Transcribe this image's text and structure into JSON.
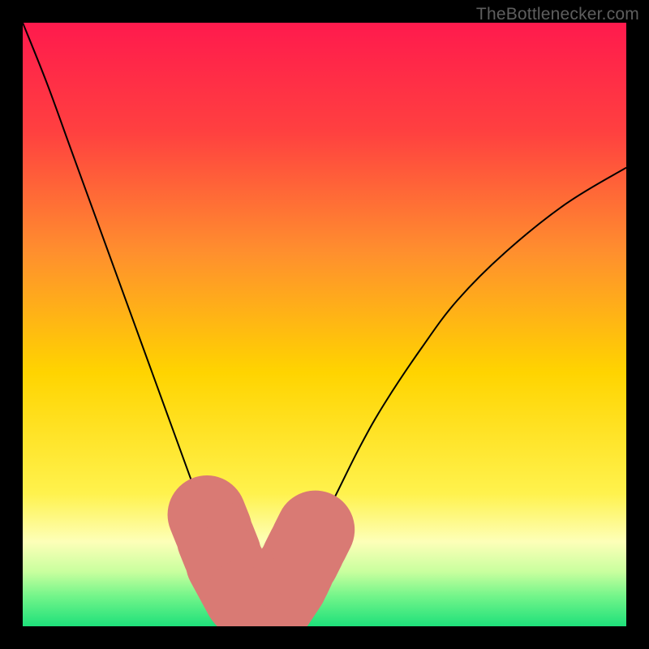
{
  "watermark": "TheBottlenecker.com",
  "chart_data": {
    "type": "line",
    "title": "",
    "xlabel": "",
    "ylabel": "",
    "xlim": [
      0,
      100
    ],
    "ylim": [
      0,
      100
    ],
    "gradient_stops": [
      {
        "t": 0.0,
        "color": "#ff1a4d"
      },
      {
        "t": 0.18,
        "color": "#ff4040"
      },
      {
        "t": 0.38,
        "color": "#ff8f2e"
      },
      {
        "t": 0.58,
        "color": "#ffd400"
      },
      {
        "t": 0.78,
        "color": "#fff24d"
      },
      {
        "t": 0.86,
        "color": "#fdffb8"
      },
      {
        "t": 0.91,
        "color": "#c8ff9e"
      },
      {
        "t": 0.95,
        "color": "#73f58a"
      },
      {
        "t": 1.0,
        "color": "#1ee07a"
      }
    ],
    "series": [
      {
        "name": "bottleneck-curve",
        "x": [
          0,
          4,
          8,
          12,
          16,
          20,
          24,
          28,
          30,
          32,
          34,
          36,
          37,
          38,
          39,
          40,
          42,
          44,
          46,
          48,
          52,
          56,
          60,
          66,
          72,
          80,
          90,
          100
        ],
        "y": [
          100,
          90,
          79,
          68,
          57,
          46,
          35,
          24,
          19,
          14,
          10,
          7,
          5,
          4,
          3.5,
          3.5,
          4,
          6,
          10,
          14,
          22,
          30,
          37,
          46,
          54,
          62,
          70,
          76
        ]
      }
    ],
    "marker_segments": [
      {
        "x0": 30.5,
        "y0": 18.5,
        "x1": 31.5,
        "y1": 16.0
      },
      {
        "x0": 32.0,
        "y0": 14.5,
        "x1": 33.0,
        "y1": 12.0
      },
      {
        "x0": 33.5,
        "y0": 10.5,
        "x1": 36.5,
        "y1": 5.0
      },
      {
        "x0": 36.8,
        "y0": 4.6,
        "x1": 41.5,
        "y1": 3.8
      },
      {
        "x0": 42.0,
        "y0": 4.0,
        "x1": 44.0,
        "y1": 7.0
      },
      {
        "x0": 44.5,
        "y0": 8.0,
        "x1": 45.2,
        "y1": 9.5
      },
      {
        "x0": 46.0,
        "y0": 11.0,
        "x1": 47.0,
        "y1": 13.0
      },
      {
        "x0": 47.5,
        "y0": 14.0,
        "x1": 48.5,
        "y1": 16.0
      }
    ],
    "marker_color": "#d97a74",
    "curve_color": "#000000"
  }
}
